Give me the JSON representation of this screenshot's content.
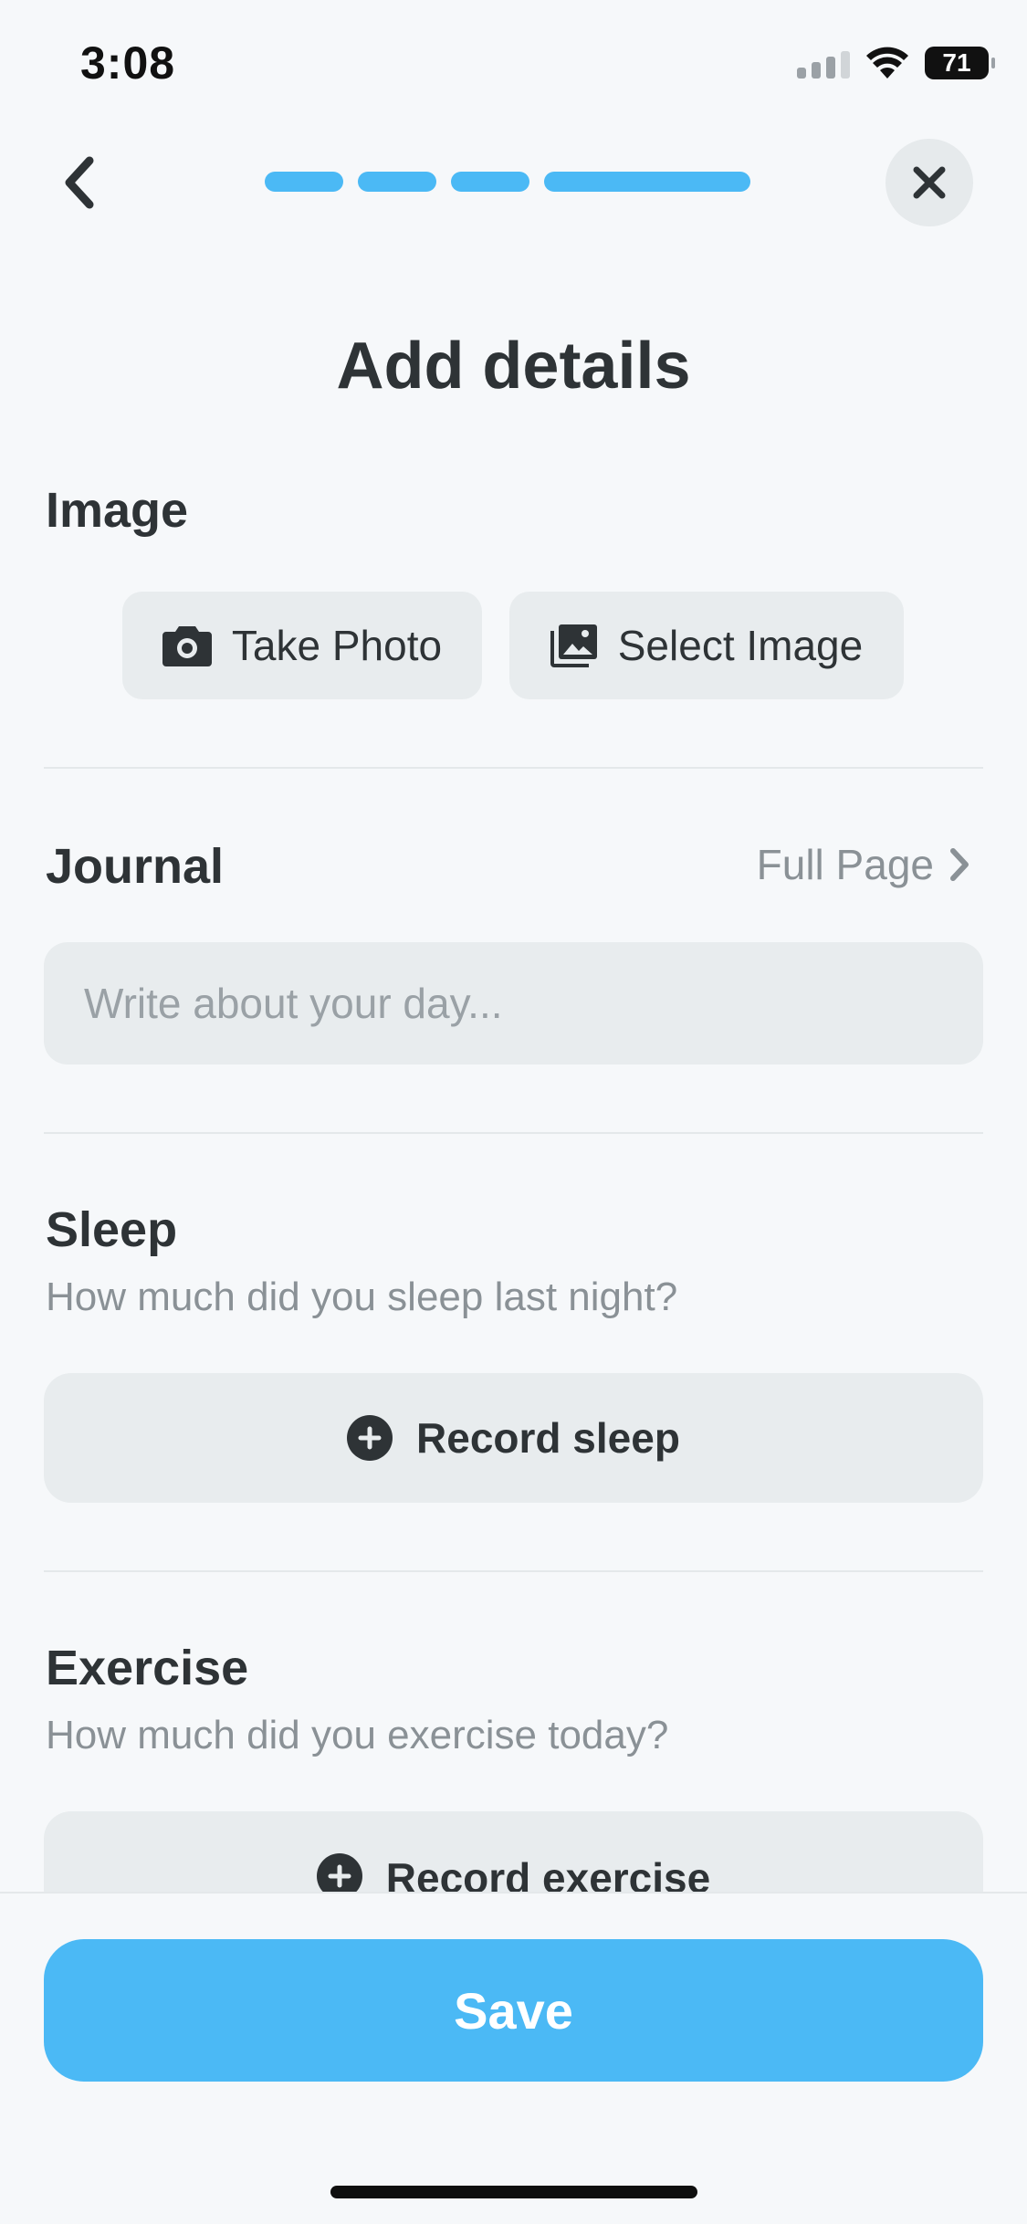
{
  "status": {
    "time": "3:08",
    "battery": "71"
  },
  "nav": {
    "progress_steps": 4,
    "completed_steps": 4
  },
  "title": "Add details",
  "image_section": {
    "title": "Image",
    "take_photo_label": "Take Photo",
    "select_image_label": "Select Image"
  },
  "journal_section": {
    "title": "Journal",
    "full_page_label": "Full Page",
    "placeholder": "Write about your day..."
  },
  "sleep_section": {
    "title": "Sleep",
    "subtitle": "How much did you sleep last night?",
    "record_label": "Record sleep"
  },
  "exercise_section": {
    "title": "Exercise",
    "subtitle": "How much did you exercise today?",
    "record_label": "Record exercise"
  },
  "save_label": "Save",
  "colors": {
    "accent": "#4BB9F5",
    "background": "#F6F8FA",
    "surface": "#E8ECEE",
    "text": "#2E3336",
    "muted": "#8A9196"
  }
}
